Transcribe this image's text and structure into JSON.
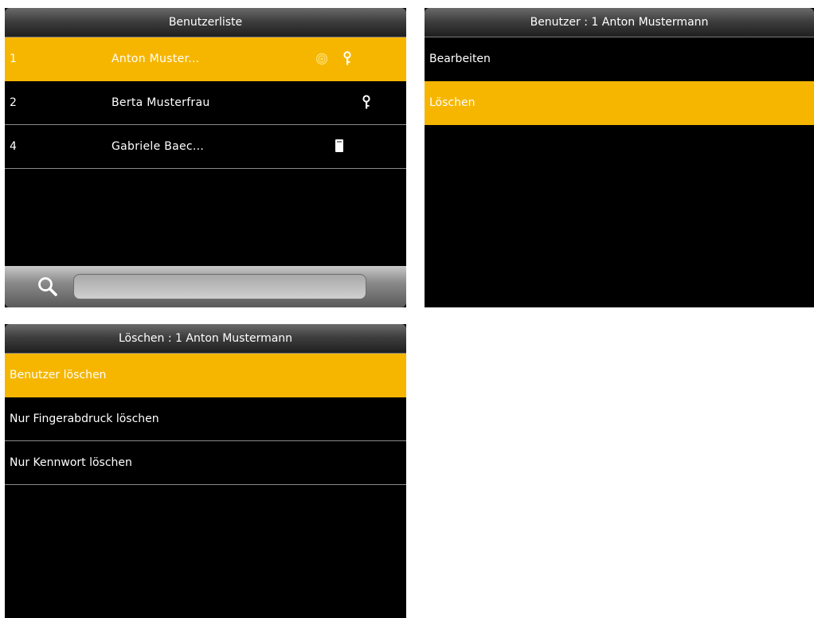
{
  "screen1": {
    "title": "Benutzerliste",
    "users": [
      {
        "num": "1",
        "name": "Anton  Muster...",
        "icons": [
          "fingerprint-icon",
          "key-icon"
        ],
        "selected": true
      },
      {
        "num": "2",
        "name": "Berta Musterfrau",
        "icons": [
          "key-icon"
        ],
        "selected": false
      },
      {
        "num": "4",
        "name": "Gabriele Baec...",
        "icons": [
          "card-icon"
        ],
        "selected": false
      }
    ],
    "search": {
      "value": ""
    }
  },
  "screen2": {
    "title": "Benutzer : 1 Anton  Mustermann",
    "items": [
      {
        "label": "Bearbeiten",
        "selected": false
      },
      {
        "label": "Löschen",
        "selected": true
      }
    ]
  },
  "screen3": {
    "title": "Löschen : 1 Anton  Mustermann",
    "items": [
      {
        "label": "Benutzer löschen",
        "selected": true
      },
      {
        "label": "Nur Fingerabdruck löschen",
        "selected": false
      },
      {
        "label": "Nur Kennwort löschen",
        "selected": false
      }
    ]
  },
  "colors": {
    "accent": "#f6b600",
    "background": "#000000",
    "text": "#ffffff"
  }
}
